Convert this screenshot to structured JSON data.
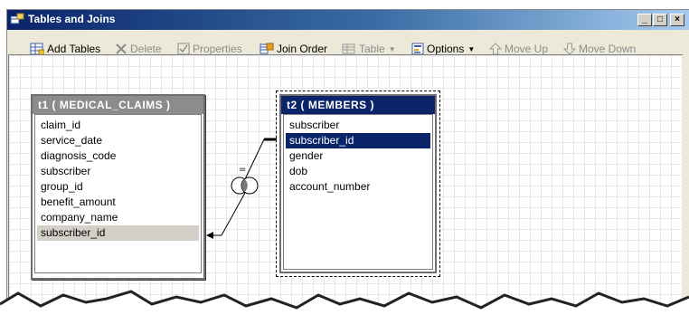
{
  "window": {
    "title": "Tables and Joins",
    "controls": [
      "_",
      "□",
      "×"
    ]
  },
  "toolbar": {
    "add_tables": "Add Tables",
    "delete": "Delete",
    "properties": "Properties",
    "join_order": "Join Order",
    "table": "Table",
    "options": "Options",
    "move_up": "Move Up",
    "move_down": "Move Down"
  },
  "tables": [
    {
      "title": "t1 ( MEDICAL_CLAIMS )",
      "header_color": "#8c8c8c",
      "columns": [
        "claim_id",
        "service_date",
        "diagnosis_code",
        "subscriber",
        "group_id",
        "benefit_amount",
        "company_name",
        "subscriber_id"
      ],
      "selected_column": "subscriber_id"
    },
    {
      "title": "t2 ( MEMBERS )",
      "header_color": "#0a246a",
      "columns": [
        "subscriber",
        "subscriber_id",
        "gender",
        "dob",
        "account_number"
      ],
      "selected_column": "subscriber_id"
    }
  ],
  "join": {
    "operator": "=",
    "type_icon": "inner-join-venn-icon"
  },
  "colors": {
    "title_bar_start": "#0a246a",
    "title_bar_end": "#a6caf0",
    "selection": "#0a246a",
    "inactive_header": "#8c8c8c"
  }
}
